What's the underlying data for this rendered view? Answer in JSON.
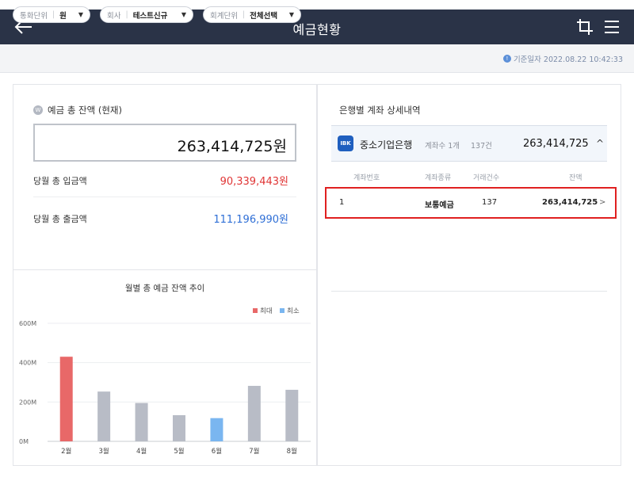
{
  "header": {
    "title": "예금현황"
  },
  "filters": [
    {
      "label": "통화단위",
      "value": "원"
    },
    {
      "label": "회사",
      "value": "테스트신규"
    },
    {
      "label": "회계단위",
      "value": "전체선택"
    }
  ],
  "base_date": "기준일자 2022.08.22 10:42:33",
  "summary": {
    "title": "예금 총 잔액 (현재)",
    "total": "263,414,725원",
    "deposit_label": "당월 총 입금액",
    "deposit_value": "90,339,443원",
    "withdraw_label": "당월 총 출금액",
    "withdraw_value": "111,196,990원"
  },
  "colors": {
    "header_bg": "#2a3347",
    "deposit": "#e03535",
    "withdraw": "#2f6fd6",
    "max_bar": "#e86868",
    "min_bar": "#7ab6f0",
    "bar": "#b8bcc6",
    "highlight": "#e02020"
  },
  "right": {
    "title": "은행별 계좌 상세내역",
    "bank": {
      "logo": "IBK",
      "name": "중소기업은행",
      "count": "계좌수 1개",
      "trx": "137건",
      "amount": "263,414,725"
    },
    "columns": [
      "계좌번호",
      "계좌종류",
      "거래건수",
      "잔액"
    ],
    "accounts": [
      {
        "no": "1",
        "type": "보통예금",
        "trx": "137",
        "balance": "263,414,725"
      }
    ]
  },
  "chart_data": {
    "type": "bar",
    "title": "월별 총 예금 잔액 추이",
    "categories": [
      "2월",
      "3월",
      "4월",
      "5월",
      "6월",
      "7월",
      "8월"
    ],
    "values": [
      430,
      253,
      195,
      133,
      118,
      282,
      262
    ],
    "highlight": [
      "max",
      "normal",
      "normal",
      "normal",
      "min",
      "normal",
      "normal"
    ],
    "ylim": [
      0,
      600
    ],
    "yticks": [
      0,
      200,
      400,
      600
    ],
    "ytick_labels": [
      "0M",
      "200M",
      "400M",
      "600M"
    ],
    "legend": [
      {
        "name": "최대",
        "color": "#e86868"
      },
      {
        "name": "최소",
        "color": "#7ab6f0"
      }
    ],
    "legend_position": "top-right",
    "grid": true
  }
}
